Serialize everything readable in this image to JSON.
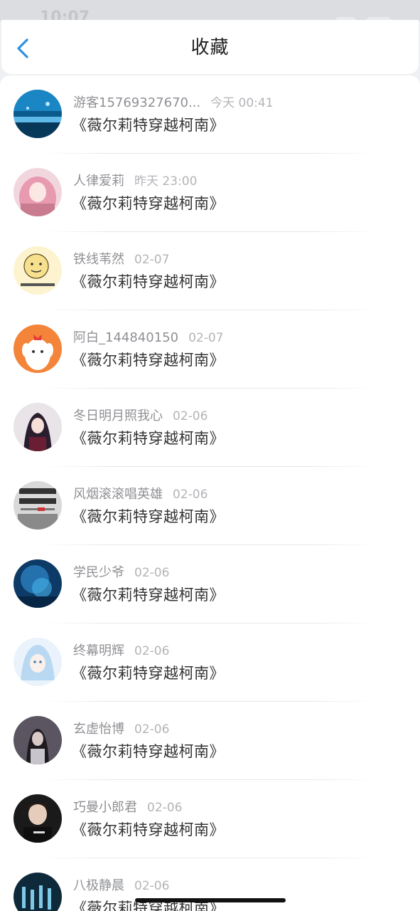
{
  "status_bar": {
    "time": "10:07"
  },
  "header": {
    "title": "收藏"
  },
  "favorites": [
    {
      "username": "游客15769327670...",
      "time": "今天 00:41",
      "title": "《薇尔莉特穿越柯南》",
      "avatar": "ocean-aquarium"
    },
    {
      "username": "人律爱莉",
      "time": "昨天 23:00",
      "title": "《薇尔莉特穿越柯南》",
      "avatar": "pink-anime-girl"
    },
    {
      "username": "铁线苇然",
      "time": "02-07",
      "title": "《薇尔莉特穿越柯南》",
      "avatar": "meme-face"
    },
    {
      "username": "阿白_144840150",
      "time": "02-07",
      "title": "《薇尔莉特穿越柯南》",
      "avatar": "cartoon-dog"
    },
    {
      "username": "冬日明月照我心",
      "time": "02-06",
      "title": "《薇尔莉特穿越柯南》",
      "avatar": "dark-anime-girl"
    },
    {
      "username": "风烟滚滚唱英雄",
      "time": "02-06",
      "title": "《薇尔莉特穿越柯南》",
      "avatar": "calligraphy-poster"
    },
    {
      "username": "学民少爷",
      "time": "02-06",
      "title": "《薇尔莉特穿越柯南》",
      "avatar": "underwater-blue"
    },
    {
      "username": "终幕明辉",
      "time": "02-06",
      "title": "《薇尔莉特穿越柯南》",
      "avatar": "light-anime-girl"
    },
    {
      "username": "玄虚怡博",
      "time": "02-06",
      "title": "《薇尔莉特穿越柯南》",
      "avatar": "dark-portrait"
    },
    {
      "username": "巧曼小郎君",
      "time": "02-06",
      "title": "《薇尔莉特穿越柯南》",
      "avatar": "boy-photo"
    },
    {
      "username": "八极静晨",
      "time": "02-06",
      "title": "《薇尔莉特穿越柯南》",
      "avatar": "dancers-stage"
    }
  ],
  "colors": {
    "accent": "#2f8fe0",
    "text_primary": "#333333",
    "text_secondary": "#8f9094",
    "background": "#eef0f3"
  }
}
